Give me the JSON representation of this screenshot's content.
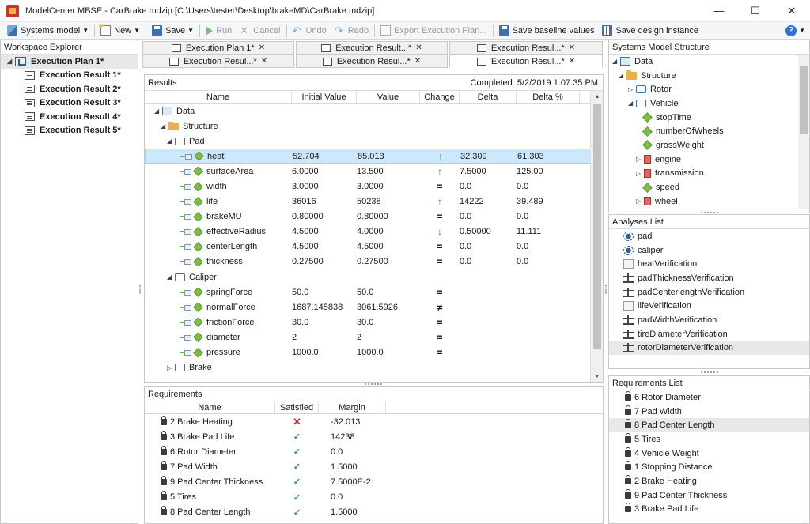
{
  "window": {
    "title": "ModelCenter MBSE - CarBrake.mdzip [C:\\Users\\tester\\Desktop\\brakeMD\\CarBrake.mdzip]",
    "minimize": "—",
    "maximize": "☐",
    "close": "✕"
  },
  "toolbar": {
    "systems_model": "Systems model",
    "new": "New",
    "save": "Save",
    "run": "Run",
    "cancel": "Cancel",
    "undo": "Undo",
    "redo": "Redo",
    "export": "Export Execution Plan...",
    "save_baseline": "Save baseline values",
    "save_design": "Save design instance",
    "help": "?"
  },
  "workspace": {
    "title": "Workspace Explorer",
    "root": "Execution Plan 1*",
    "items": [
      "Execution Result 1*",
      "Execution Result 2*",
      "Execution Result 3*",
      "Execution Result 4*",
      "Execution Result 5*"
    ]
  },
  "tabs": {
    "row1": [
      "Execution Plan 1*",
      "Execution Result...*",
      "Execution Resul...*"
    ],
    "row2": [
      "Execution Resul...*",
      "Execution Resul...*",
      "Execution Resul...*"
    ],
    "close": "✕"
  },
  "results": {
    "title": "Results",
    "completed": "Completed: 5/2/2019 1:07:35 PM",
    "columns": [
      "Name",
      "Initial Value",
      "Value",
      "Change",
      "Delta",
      "Delta %"
    ],
    "rows": [
      {
        "name": "Data",
        "initial": "",
        "value": "",
        "change": "",
        "delta": "",
        "dpct": ""
      },
      {
        "name": "Structure",
        "initial": "",
        "value": "",
        "change": "",
        "delta": "",
        "dpct": ""
      },
      {
        "name": "Pad",
        "initial": "",
        "value": "",
        "change": "",
        "delta": "",
        "dpct": ""
      },
      {
        "name": "heat",
        "initial": "52.704",
        "value": "85.013",
        "change": "↑",
        "delta": "32.309",
        "dpct": "61.303"
      },
      {
        "name": "surfaceArea",
        "initial": "6.0000",
        "value": "13.500",
        "change": "↑",
        "delta": "7.5000",
        "dpct": "125.00"
      },
      {
        "name": "width",
        "initial": "3.0000",
        "value": "3.0000",
        "change": "=",
        "delta": "0.0",
        "dpct": "0.0"
      },
      {
        "name": "life",
        "initial": "36016",
        "value": "50238",
        "change": "↑",
        "delta": "14222",
        "dpct": "39.489"
      },
      {
        "name": "brakeMU",
        "initial": "0.80000",
        "value": "0.80000",
        "change": "=",
        "delta": "0.0",
        "dpct": "0.0"
      },
      {
        "name": "effectiveRadius",
        "initial": "4.5000",
        "value": "4.0000",
        "change": "↓",
        "delta": "0.50000",
        "dpct": "11.111"
      },
      {
        "name": "centerLength",
        "initial": "4.5000",
        "value": "4.5000",
        "change": "=",
        "delta": "0.0",
        "dpct": "0.0"
      },
      {
        "name": "thickness",
        "initial": "0.27500",
        "value": "0.27500",
        "change": "=",
        "delta": "0.0",
        "dpct": "0.0"
      },
      {
        "name": "Caliper",
        "initial": "",
        "value": "",
        "change": "",
        "delta": "",
        "dpct": ""
      },
      {
        "name": "springForce",
        "initial": "50.0",
        "value": "50.0",
        "change": "=",
        "delta": "",
        "dpct": ""
      },
      {
        "name": "normalForce",
        "initial": "1687.145838",
        "value": "3061.5926",
        "change": "≠",
        "delta": "",
        "dpct": ""
      },
      {
        "name": "frictionForce",
        "initial": "30.0",
        "value": "30.0",
        "change": "=",
        "delta": "",
        "dpct": ""
      },
      {
        "name": "diameter",
        "initial": "2",
        "value": "2",
        "change": "=",
        "delta": "",
        "dpct": ""
      },
      {
        "name": "pressure",
        "initial": "1000.0",
        "value": "1000.0",
        "change": "=",
        "delta": "",
        "dpct": ""
      },
      {
        "name": "Brake",
        "initial": "",
        "value": "",
        "change": "",
        "delta": "",
        "dpct": ""
      }
    ]
  },
  "requirements": {
    "title": "Requirements",
    "columns": [
      "Name",
      "Satisfied",
      "Margin"
    ],
    "rows": [
      {
        "name": "2  Brake Heating",
        "satisfied": "✕",
        "margin": "-32.013"
      },
      {
        "name": "3  Brake Pad Life",
        "satisfied": "✓",
        "margin": "14238"
      },
      {
        "name": "6  Rotor Diameter",
        "satisfied": "✓",
        "margin": "0.0"
      },
      {
        "name": "7  Pad Width",
        "satisfied": "✓",
        "margin": "1.5000"
      },
      {
        "name": "9  Pad Center Thickness",
        "satisfied": "✓",
        "margin": "7.5000E-2"
      },
      {
        "name": "5  Tires",
        "satisfied": "✓",
        "margin": "0.0"
      },
      {
        "name": "8  Pad Center Length",
        "satisfied": "✓",
        "margin": "1.5000"
      }
    ]
  },
  "sms": {
    "title": "Systems Model Structure",
    "items": [
      "Data",
      "Structure",
      "Rotor",
      "Vehicle",
      "stopTime",
      "numberOfWheels",
      "grossWeight",
      "engine",
      "transmission",
      "speed",
      "wheel"
    ]
  },
  "analyses": {
    "title": "Analyses List",
    "items": [
      "pad",
      "caliper",
      "heatVerification",
      "padThicknessVerification",
      "padCenterlengthVerification",
      "lifeVerification",
      "padWidthVerification",
      "tireDiameterVerification",
      "rotorDiameterVerification"
    ]
  },
  "reqlist": {
    "title": "Requirements List",
    "items": [
      "6  Rotor Diameter",
      "7  Pad Width",
      "8  Pad Center Length",
      "5  Tires",
      "4  Vehicle Weight",
      "1  Stopping Distance",
      "2  Brake Heating",
      "9  Pad Center Thickness",
      "3  Brake Pad Life"
    ]
  }
}
